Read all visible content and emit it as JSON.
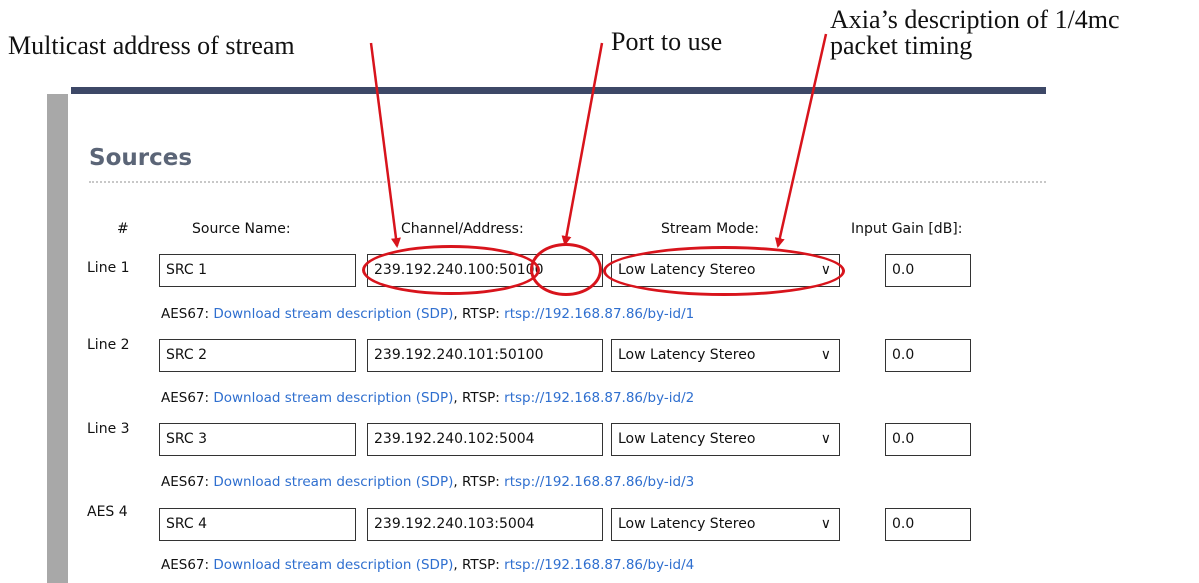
{
  "annotations": {
    "multicast": "Multicast address of stream",
    "port": "Port to use",
    "axia_line1": "Axia’s description of 1/4mc",
    "axia_line2": "packet timing"
  },
  "page_title": "Sources",
  "headers": {
    "number": "#",
    "source_name": "Source Name:",
    "channel_address": "Channel/Address:",
    "stream_mode": "Stream Mode:",
    "input_gain": "Input Gain [dB]:"
  },
  "rows": [
    {
      "label": "Line 1",
      "name": "SRC 1",
      "address": "239.192.240.100:50100",
      "mode": "Low Latency Stereo",
      "gain": "0.0",
      "aes67_label": "AES67:",
      "sdp_link": "Download stream description (SDP)",
      "rtsp_label": ", RTSP:",
      "rtsp_link": "rtsp://192.168.87.86/by-id/1"
    },
    {
      "label": "Line 2",
      "name": "SRC 2",
      "address": "239.192.240.101:50100",
      "mode": "Low Latency Stereo",
      "gain": "0.0",
      "aes67_label": "AES67:",
      "sdp_link": "Download stream description (SDP)",
      "rtsp_label": ", RTSP:",
      "rtsp_link": "rtsp://192.168.87.86/by-id/2"
    },
    {
      "label": "Line 3",
      "name": "SRC 3",
      "address": "239.192.240.102:5004",
      "mode": "Low Latency Stereo",
      "gain": "0.0",
      "aes67_label": "AES67:",
      "sdp_link": "Download stream description (SDP)",
      "rtsp_label": ", RTSP:",
      "rtsp_link": "rtsp://192.168.87.86/by-id/3"
    },
    {
      "label": "AES 4",
      "name": "SRC 4",
      "address": "239.192.240.103:5004",
      "mode": "Low Latency Stereo",
      "gain": "0.0",
      "aes67_label": "AES67:",
      "sdp_link": "Download stream description (SDP)",
      "rtsp_label": ", RTSP:",
      "rtsp_link": "rtsp://192.168.87.86/by-id/4"
    }
  ],
  "colors": {
    "annotation_red": "#d8141c",
    "header_bar": "#3d4867",
    "title": "#5b6577",
    "link": "#2f6fcf"
  },
  "icons": {
    "dropdown": "chevron-down-icon"
  }
}
